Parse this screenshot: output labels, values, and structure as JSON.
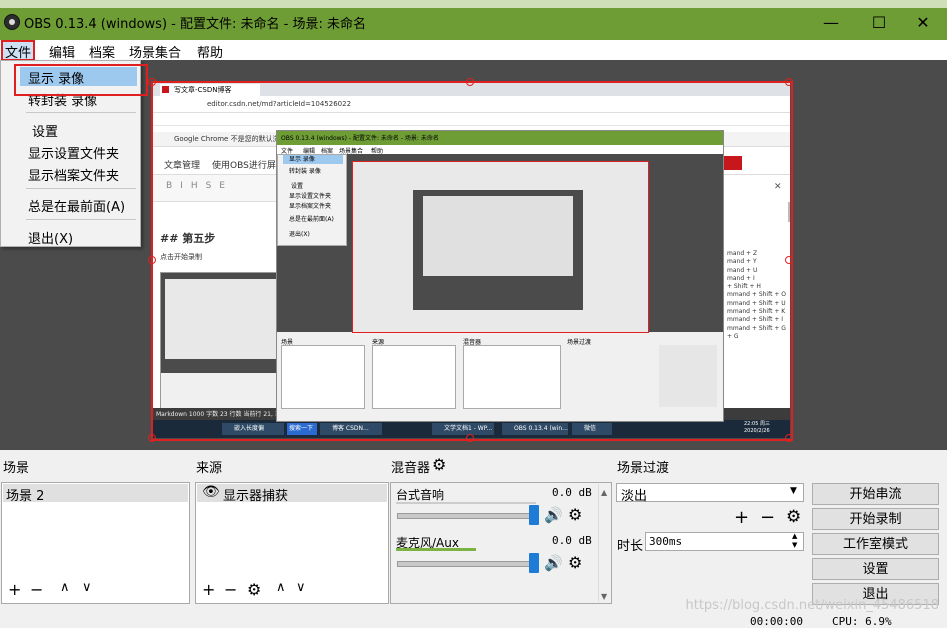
{
  "window": {
    "title": "OBS 0.13.4 (windows) - 配置文件: 未命名 - 场景: 未命名",
    "minimize": "—",
    "maximize": "☐",
    "close": "✕"
  },
  "menubar": [
    "文件",
    "编辑",
    "档案",
    "场景集合",
    "帮助"
  ],
  "file_menu": {
    "items": [
      "显示 录像",
      "转封装 录像",
      "设置",
      "显示设置文件夹",
      "显示档案文件夹",
      "总是在最前面(A)",
      "退出(X)"
    ]
  },
  "capture": {
    "browser_tab": "写文章-CSDN博客",
    "browser_url": "editor.csdn.net/md?articleId=104526022",
    "banner": "Google Chrome 不是您的默认浏览器",
    "article_nav": "文章管理",
    "article_title": "使用OBS进行屏",
    "heading": "## 第五步",
    "subtext": "点击开始录制",
    "status": "Markdown  1000 字数  23 行数  当前行 21, 当前",
    "inner_title": "OBS 0.13.4 (windows) - 配置文件: 未命名 - 场景: 未命名",
    "inner_menu": [
      "文件",
      "编辑",
      "档案",
      "场景集合",
      "帮助"
    ],
    "inner_file_menu": [
      "显示 录像",
      "转封装 录像",
      "设置",
      "显示设置文件夹",
      "显示档案文件夹",
      "总是在最前面(A)",
      "退出(X)"
    ],
    "shortcuts": [
      "mand + Z",
      "mand + Y",
      "mand + U",
      "mand + I",
      "+ Shift + H",
      "mmand + Shift + O",
      "mmand + Shift + U",
      "mmand + Shift + K",
      "mmand + Shift + I",
      "mmand + Shift + G",
      "+ G"
    ],
    "taskbar_items": [
      "嵌入长度偏",
      "搜索一下",
      "博客 CSDN...",
      "文学文档1 - WP...",
      "OBS 0.13.4 (win...",
      "微信"
    ],
    "clock": "22:05 周三\n2020/2/26"
  },
  "scenes": {
    "title": "场景",
    "items": [
      "场景 2"
    ]
  },
  "sources": {
    "title": "来源",
    "items": [
      "显示器捕获"
    ]
  },
  "mixer": {
    "title": "混音器",
    "channels": [
      {
        "name": "台式音响",
        "level": "0.0 dB",
        "volume": 0.95
      },
      {
        "name": "麦克风/Aux",
        "level": "0.0 dB",
        "volume": 0.95
      }
    ]
  },
  "transitions": {
    "title": "场景过渡",
    "selected": "淡出",
    "duration_label": "时长",
    "duration_value": "300ms"
  },
  "controls": [
    "开始串流",
    "开始录制",
    "工作室模式",
    "设置",
    "退出"
  ],
  "statusbar": {
    "time": "00:00:00",
    "cpu": "CPU: 6.9%"
  },
  "watermark": "https://blog.csdn.net/weixin_45486518",
  "colors": {
    "titlebar": "#6e9d36",
    "highlight": "#9ec9ee",
    "annotation_red": "#e02020",
    "slider_blue": "#1e7bd6"
  }
}
